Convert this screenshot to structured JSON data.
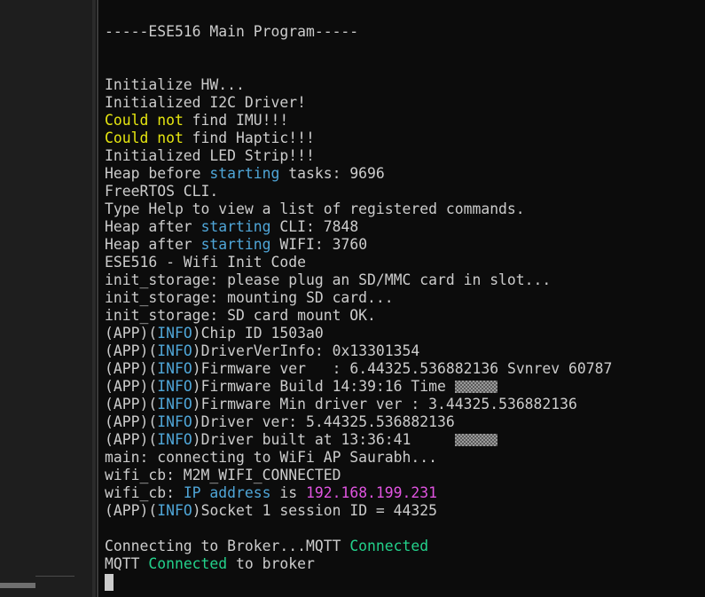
{
  "terminal": {
    "header": "-----ESE516 Main Program-----",
    "lines": [
      {
        "parts": [
          {
            "t": "Initialize HW...",
            "c": ""
          }
        ]
      },
      {
        "parts": [
          {
            "t": "Initialized I2C Driver!",
            "c": ""
          }
        ]
      },
      {
        "parts": [
          {
            "t": "Could not",
            "c": "yellow"
          },
          {
            "t": " find IMU!!!",
            "c": ""
          }
        ]
      },
      {
        "parts": [
          {
            "t": "Could not",
            "c": "yellow"
          },
          {
            "t": " find Haptic!!!",
            "c": ""
          }
        ]
      },
      {
        "parts": [
          {
            "t": "Initialized LED Strip!!!",
            "c": ""
          }
        ]
      },
      {
        "parts": [
          {
            "t": "Heap before ",
            "c": ""
          },
          {
            "t": "starting",
            "c": "cyan"
          },
          {
            "t": " tasks: 9696",
            "c": ""
          }
        ]
      },
      {
        "parts": [
          {
            "t": "FreeRTOS CLI.",
            "c": ""
          }
        ]
      },
      {
        "parts": [
          {
            "t": "Type Help to view a list of registered commands.",
            "c": ""
          }
        ]
      },
      {
        "parts": [
          {
            "t": "Heap after ",
            "c": ""
          },
          {
            "t": "starting",
            "c": "cyan"
          },
          {
            "t": " CLI: 7848",
            "c": ""
          }
        ]
      },
      {
        "parts": [
          {
            "t": "Heap after ",
            "c": ""
          },
          {
            "t": "starting",
            "c": "cyan"
          },
          {
            "t": " WIFI: 3760",
            "c": ""
          }
        ]
      },
      {
        "parts": [
          {
            "t": "ESE516 - Wifi Init Code",
            "c": ""
          }
        ]
      },
      {
        "parts": [
          {
            "t": "init_storage: please plug an SD/MMC card in slot...",
            "c": ""
          }
        ]
      },
      {
        "parts": [
          {
            "t": "init_storage: mounting SD card...",
            "c": ""
          }
        ]
      },
      {
        "parts": [
          {
            "t": "init_storage: SD card mount OK.",
            "c": ""
          }
        ]
      },
      {
        "parts": [
          {
            "t": "(APP)(",
            "c": ""
          },
          {
            "t": "INFO",
            "c": "cyan"
          },
          {
            "t": ")Chip ID 1503a0",
            "c": ""
          }
        ]
      },
      {
        "parts": [
          {
            "t": "(APP)(",
            "c": ""
          },
          {
            "t": "INFO",
            "c": "cyan"
          },
          {
            "t": ")DriverVerInfo: 0x13301354",
            "c": ""
          }
        ]
      },
      {
        "parts": [
          {
            "t": "(APP)(",
            "c": ""
          },
          {
            "t": "INFO",
            "c": "cyan"
          },
          {
            "t": ")Firmware ver   : 6.44325.536882136 Svnrev 60787",
            "c": ""
          }
        ]
      },
      {
        "parts": [
          {
            "t": "(APP)(",
            "c": ""
          },
          {
            "t": "INFO",
            "c": "cyan"
          },
          {
            "t": ")Firmware Build 14:39:16 Time ",
            "c": ""
          },
          {
            "t": "",
            "c": "glitch"
          }
        ]
      },
      {
        "parts": [
          {
            "t": "(APP)(",
            "c": ""
          },
          {
            "t": "INFO",
            "c": "cyan"
          },
          {
            "t": ")Firmware Min driver ver : 3.44325.536882136",
            "c": ""
          }
        ]
      },
      {
        "parts": [
          {
            "t": "(APP)(",
            "c": ""
          },
          {
            "t": "INFO",
            "c": "cyan"
          },
          {
            "t": ")Driver ver: 5.44325.536882136",
            "c": ""
          }
        ]
      },
      {
        "parts": [
          {
            "t": "(APP)(",
            "c": ""
          },
          {
            "t": "INFO",
            "c": "cyan"
          },
          {
            "t": ")Driver built at 13:36:41     ",
            "c": ""
          },
          {
            "t": "",
            "c": "glitch"
          }
        ]
      },
      {
        "parts": [
          {
            "t": "main: connecting to WiFi AP Saurabh...",
            "c": ""
          }
        ]
      },
      {
        "parts": [
          {
            "t": "wifi_cb: M2M_WIFI_CONNECTED",
            "c": ""
          }
        ]
      },
      {
        "parts": [
          {
            "t": "wifi_cb: ",
            "c": ""
          },
          {
            "t": "IP address",
            "c": "cyan"
          },
          {
            "t": " is ",
            "c": ""
          },
          {
            "t": "192.168.199.231",
            "c": "magenta"
          }
        ]
      },
      {
        "parts": [
          {
            "t": "(APP)(",
            "c": ""
          },
          {
            "t": "INFO",
            "c": "cyan"
          },
          {
            "t": ")Socket 1 session ID = 44325",
            "c": ""
          }
        ]
      },
      {
        "parts": [
          {
            "t": "",
            "c": ""
          }
        ]
      },
      {
        "parts": [
          {
            "t": "Connecting to Broker...MQTT ",
            "c": ""
          },
          {
            "t": "Connected",
            "c": "green"
          }
        ]
      },
      {
        "parts": [
          {
            "t": "MQTT ",
            "c": ""
          },
          {
            "t": "Connected",
            "c": "green"
          },
          {
            "t": " to broker",
            "c": ""
          }
        ]
      }
    ]
  },
  "colors": {
    "background": "#0c0c0c",
    "text": "#cccccc",
    "yellow": "#e5e510",
    "cyan": "#4fa6d8",
    "green": "#23d18b",
    "magenta": "#e054e0"
  }
}
